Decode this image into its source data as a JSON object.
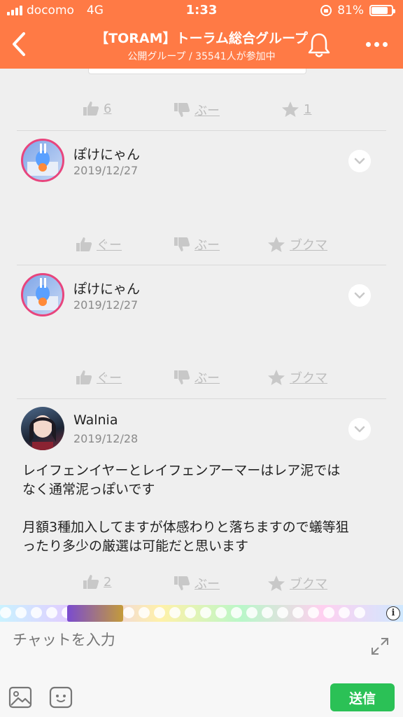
{
  "status_bar": {
    "carrier": "docomo",
    "network": "4G",
    "time": "1:33",
    "battery": "81%",
    "battery_level": 0.81
  },
  "header": {
    "title": "【TORAM】トーラム総合グループ",
    "subtitle": "公開グループ / 35541人が参加中",
    "icons": [
      "back-icon",
      "bell-icon",
      "more-icon"
    ]
  },
  "top_actions": {
    "like": "6",
    "boo": "ぶー",
    "bookmark": "1"
  },
  "posts": [
    {
      "name": "ぽけにゃん",
      "date": "2019/12/27",
      "body": [],
      "actions": {
        "like": "ぐー",
        "boo": "ぶー",
        "bookmark": "ブクマ"
      }
    },
    {
      "name": "ぽけにゃん",
      "date": "2019/12/27",
      "body": [],
      "actions": {
        "like": "ぐー",
        "boo": "ぶー",
        "bookmark": "ブクマ"
      }
    },
    {
      "name": "Walnia",
      "date": "2019/12/28",
      "body": [
        "レイフェンイヤーとレイフェンアーマーはレア泥では",
        "なく通常泥っぽいです",
        "",
        "月額3種加入してますが体感わりと落ちますので蟻等狙",
        "ったり多少の厳選は可能だと思います"
      ],
      "actions": {
        "like": "2",
        "boo": "ぶー",
        "bookmark": "ブクマ"
      }
    }
  ],
  "banner": {
    "info": "i"
  },
  "composer": {
    "placeholder": "チャットを入力",
    "send_label": "送信"
  },
  "colors": {
    "header": "#ff7a45",
    "send": "#2bc156",
    "background": "#efefef"
  }
}
